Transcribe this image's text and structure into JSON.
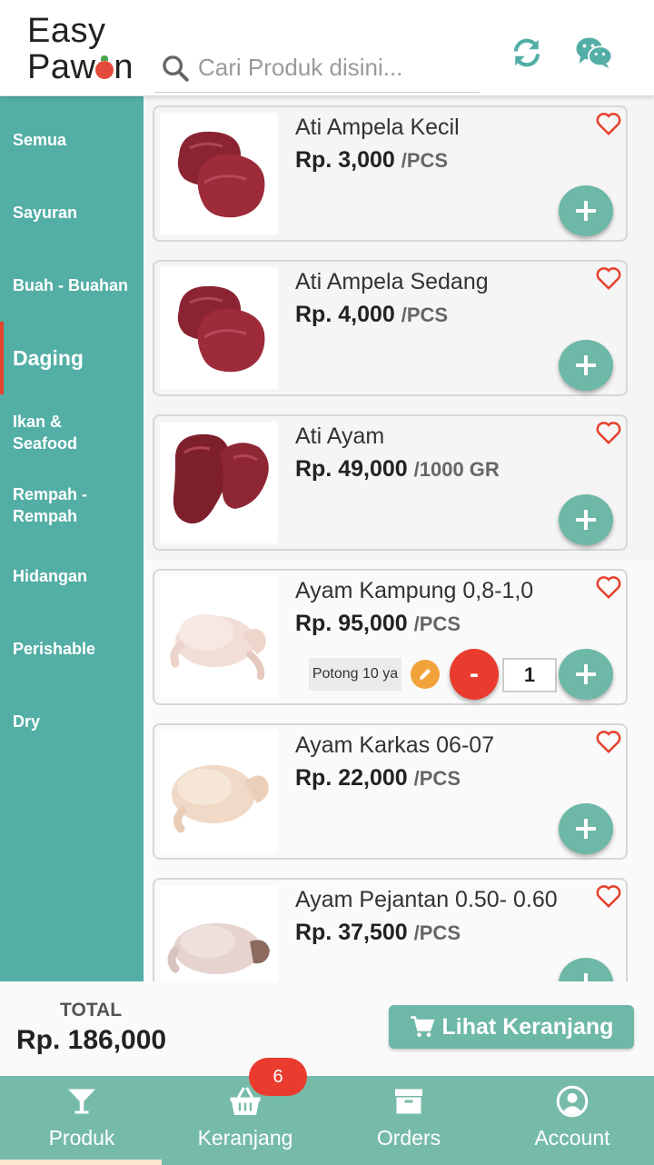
{
  "header": {
    "logo_line1": "Easy",
    "logo_line2": "Pawon",
    "search_placeholder": "Cari Produk disini..."
  },
  "sidebar": {
    "items": [
      {
        "label": "Semua"
      },
      {
        "label": "Sayuran"
      },
      {
        "label": "Buah - Buahan"
      },
      {
        "label": "Daging",
        "active": true
      },
      {
        "label": "Ikan & Seafood"
      },
      {
        "label": "Rempah - Rempah"
      },
      {
        "label": "Hidangan"
      },
      {
        "label": "Perishable"
      },
      {
        "label": "Dry"
      }
    ]
  },
  "products": [
    {
      "name": "Ati Ampela Kecil",
      "price": "Rp. 3,000",
      "unit": "/PCS",
      "image": "liver-gizzard"
    },
    {
      "name": "Ati Ampela Sedang",
      "price": "Rp. 4,000",
      "unit": "/PCS",
      "image": "liver-gizzard"
    },
    {
      "name": "Ati Ayam",
      "price": "Rp. 49,000",
      "unit": "/1000 GR",
      "image": "chicken-liver"
    },
    {
      "name": "Ayam Kampung 0,8-1,0",
      "price": "Rp. 95,000",
      "unit": "/PCS",
      "image": "whole-chicken",
      "note": "Potong 10 ya",
      "quantity": "1",
      "minus_label": "-"
    },
    {
      "name": "Ayam Karkas 06-07",
      "price": "Rp. 22,000",
      "unit": "/PCS",
      "image": "whole-chicken"
    },
    {
      "name": "Ayam Pejantan 0.50- 0.60",
      "price": "Rp. 37,500",
      "unit": "/PCS",
      "image": "whole-chicken"
    }
  ],
  "summary": {
    "total_label": "TOTAL",
    "total_value": "Rp. 186,000",
    "cart_button_label": "Lihat Keranjang"
  },
  "bottom_nav": {
    "items": [
      {
        "label": "Produk",
        "icon": "cocktail-glass-icon",
        "active": true
      },
      {
        "label": "Keranjang",
        "icon": "basket-icon",
        "badge": "6"
      },
      {
        "label": "Orders",
        "icon": "archive-box-icon"
      },
      {
        "label": "Account",
        "icon": "user-circle-icon"
      }
    ]
  },
  "colors": {
    "primary": "#53aea5",
    "button": "#6db8a6",
    "accent_red": "#ea3c2e",
    "edit_orange": "#f1a23a"
  }
}
